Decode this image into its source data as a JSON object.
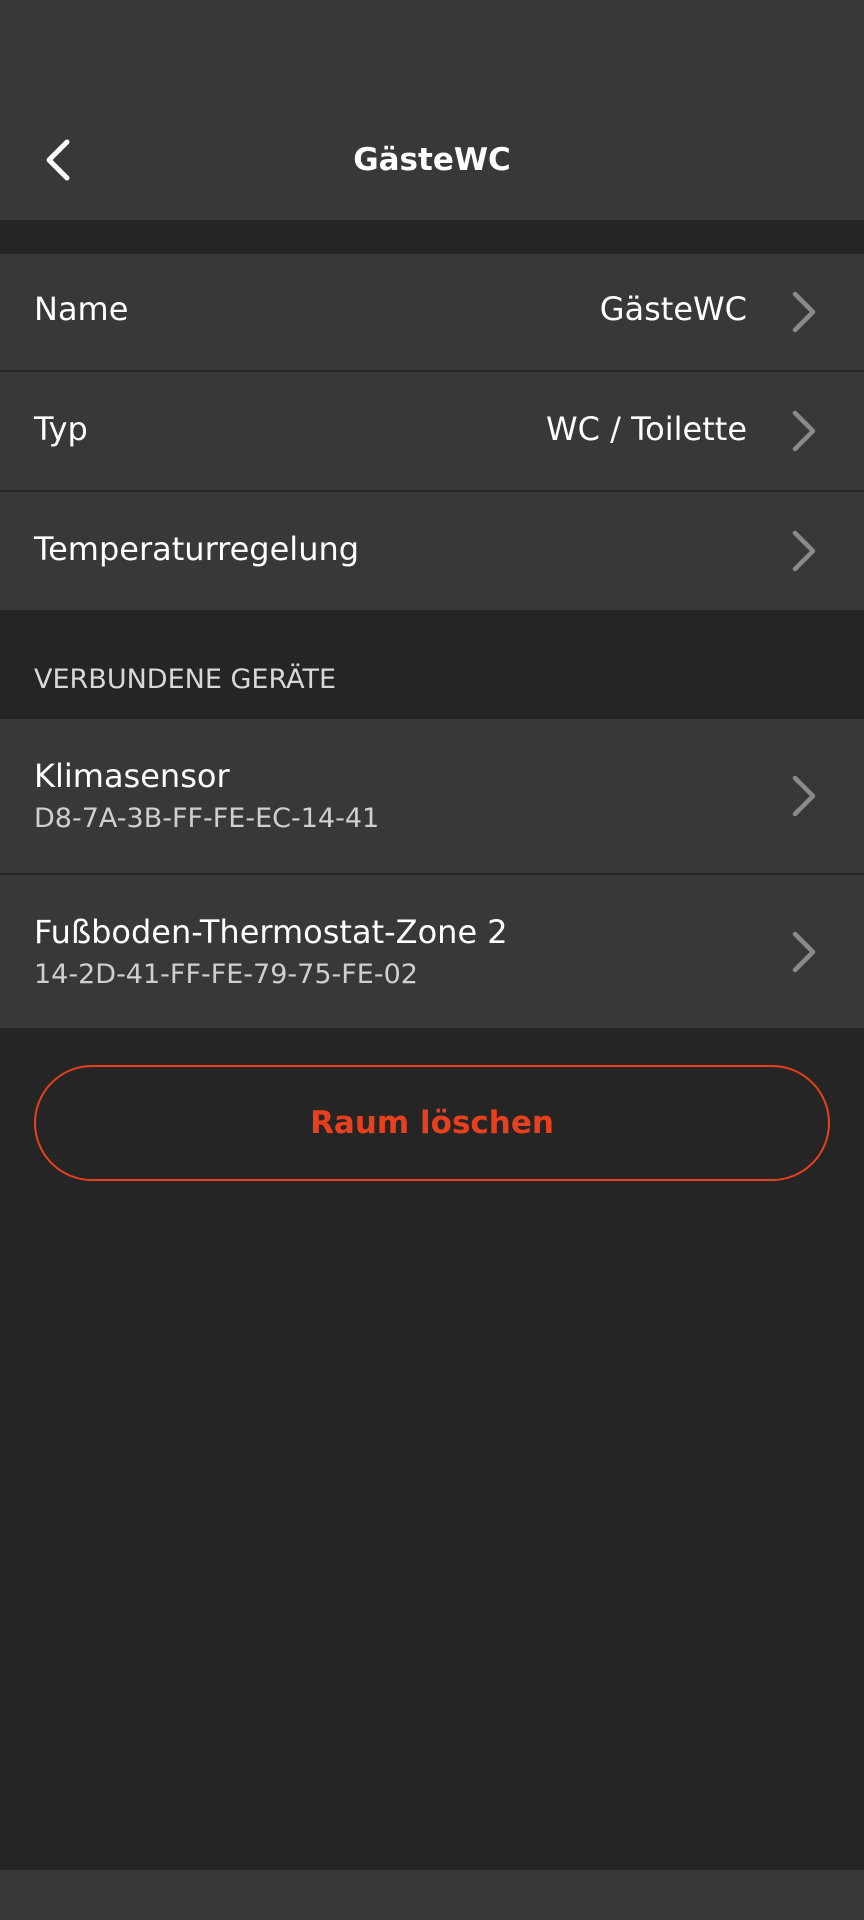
{
  "app_bar": {
    "title": "GästeWC",
    "back_icon": "chevron-left-icon"
  },
  "settings": [
    {
      "label": "Name",
      "value": "GästeWC"
    },
    {
      "label": "Typ",
      "value": "WC / Toilette"
    },
    {
      "label": "Temperaturregelung",
      "value": ""
    }
  ],
  "devices_section": {
    "header": "VERBUNDENE GERÄTE",
    "items": [
      {
        "name": "Klimasensor",
        "id": "D8-7A-3B-FF-FE-EC-14-41"
      },
      {
        "name": "Fußboden-Thermostat-Zone 2",
        "id": "14-2D-41-FF-FE-79-75-FE-02"
      }
    ]
  },
  "actions": {
    "delete_label": "Raum löschen"
  },
  "colors": {
    "background": "#252525",
    "surface": "#383838",
    "accent": "#e8401c",
    "chevron": "#8a8a8a"
  }
}
